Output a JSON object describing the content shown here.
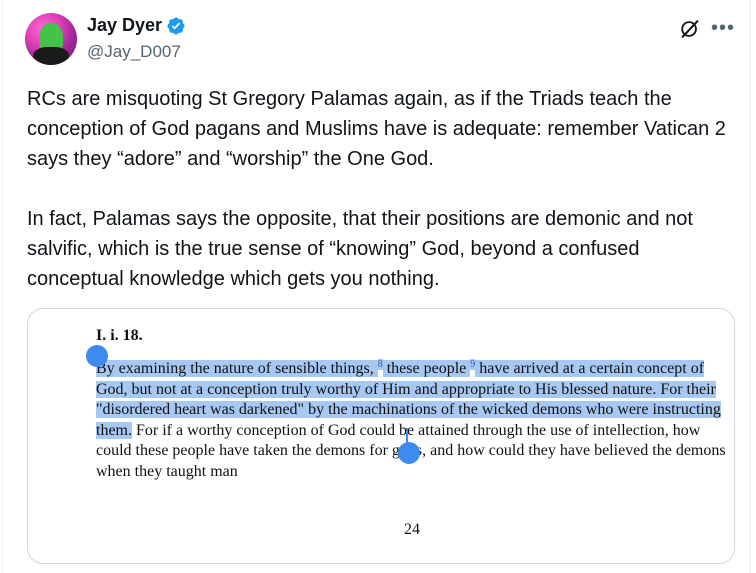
{
  "author": {
    "display_name": "Jay Dyer",
    "handle": "@Jay_D007",
    "verified": true
  },
  "icons": {
    "verified": "verified-badge-icon",
    "grok": "grok-icon",
    "more": "more-icon"
  },
  "colors": {
    "verified": "#1d9bf0",
    "text": "#0f1419",
    "secondary": "#536471",
    "highlight": "#a7c8f2",
    "selection_handle": "#3b8ced"
  },
  "tweet": {
    "paragraph_1": "RCs are misquoting St Gregory Palamas again, as if the Triads teach the conception of God pagans and Muslims have is adequate: remember Vatican 2 says they “adore” and “worship” the One God.",
    "paragraph_2": "In fact, Palamas says the opposite, that their positions are demonic and not salvific, which is the true sense of “knowing” God, beyond a confused conceptual knowledge which gets you nothing."
  },
  "media": {
    "heading": "I. i. 18.",
    "hl_1": "By examining the nature of sensible things, ",
    "sup_1": "8",
    "hl_2": " these people ",
    "sup_2": "9",
    "hl_3": " have arrived at a certain concept of God, but not at a conception truly worthy of Him and appropriate to His blessed nature. For their \"disordered heart was darkened\" by the machinations of the wicked demons who were instructing them.",
    "rest": " For if a worthy conception of God could be attained through the use of intellection, how could these people have taken the demons for gods, and how could they have believed the demons when they taught man",
    "page_number": "24"
  }
}
